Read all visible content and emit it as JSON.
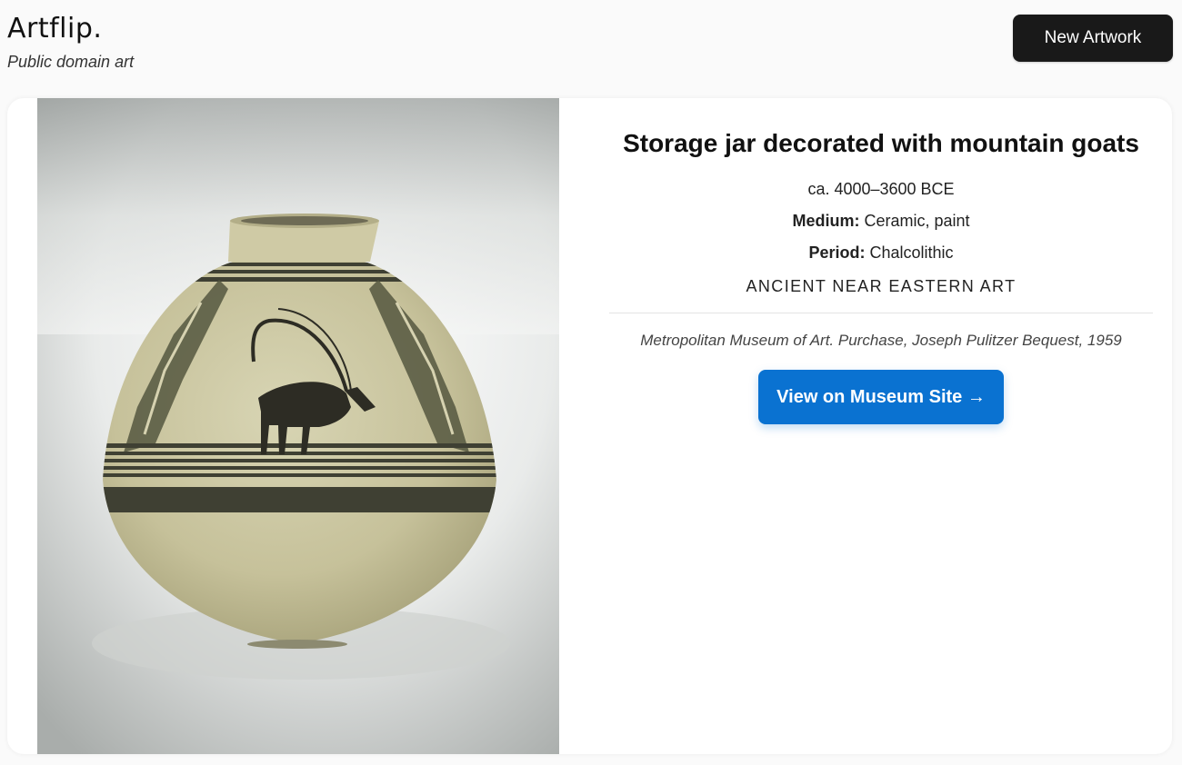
{
  "header": {
    "logo": "Artflip.",
    "tagline": "Public domain art",
    "new_artwork_label": "New Artwork"
  },
  "artwork": {
    "image_icon": "storage-jar-image",
    "title": "Storage jar decorated with mountain goats",
    "date": "ca. 4000–3600 BCE",
    "medium_label": "Medium:",
    "medium_value": "Ceramic, paint",
    "period_label": "Period:",
    "period_value": "Chalcolithic",
    "department": "ANCIENT NEAR EASTERN ART",
    "credit": "Metropolitan Museum of Art. Purchase, Joseph Pulitzer Bequest, 1959",
    "museum_link_label": "View on Museum Site →"
  },
  "colors": {
    "primary_button": "#0a72d1",
    "dark_button": "#191919"
  }
}
